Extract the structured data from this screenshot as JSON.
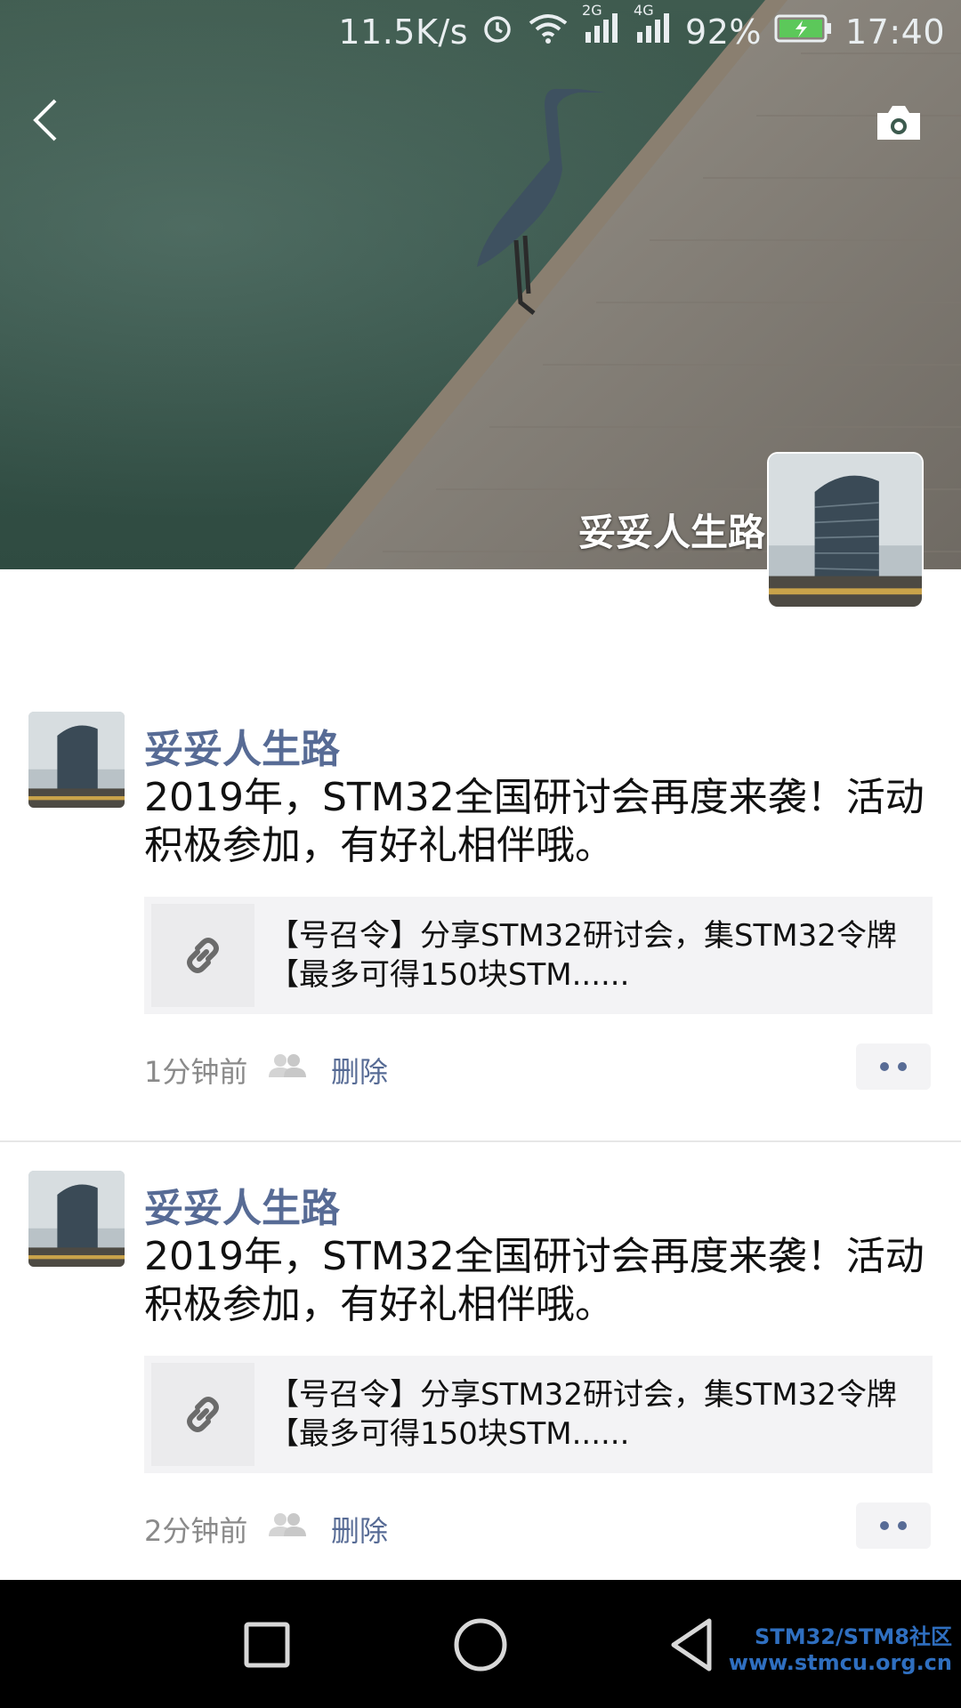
{
  "status_bar": {
    "speed": "11.5K/s",
    "network_a": "2G",
    "network_b": "4G",
    "battery": "92%",
    "time": "17:40",
    "icons": [
      "alarm-icon",
      "wifi-icon",
      "signal-icon",
      "signal-icon",
      "battery-charging-icon"
    ]
  },
  "header": {
    "back_icon": "chevron-left-icon",
    "camera_icon": "camera-icon",
    "profile_name": "妥妥人生路"
  },
  "posts": [
    {
      "author": "妥妥人生路",
      "text": "2019年，STM32全国研讨会再度来袭！活动积极参加，有好礼相伴哦。",
      "link_title": "【号召令】分享STM32研讨会，集STM32令牌【最多可得150块STM......",
      "time": "1分钟前",
      "delete_label": "删除"
    },
    {
      "author": "妥妥人生路",
      "text": "2019年，STM32全国研讨会再度来袭！活动积极参加，有好礼相伴哦。",
      "link_title": "【号召令】分享STM32研讨会，集STM32令牌【最多可得150块STM......",
      "time": "2分钟前",
      "delete_label": "删除"
    }
  ],
  "watermark": {
    "line1": "STM32/STM8社区",
    "line2": "www.stmcu.org.cn"
  },
  "colors": {
    "link_blue": "#576b95",
    "card_bg": "#f3f3f5",
    "nav_bg": "#000000"
  }
}
